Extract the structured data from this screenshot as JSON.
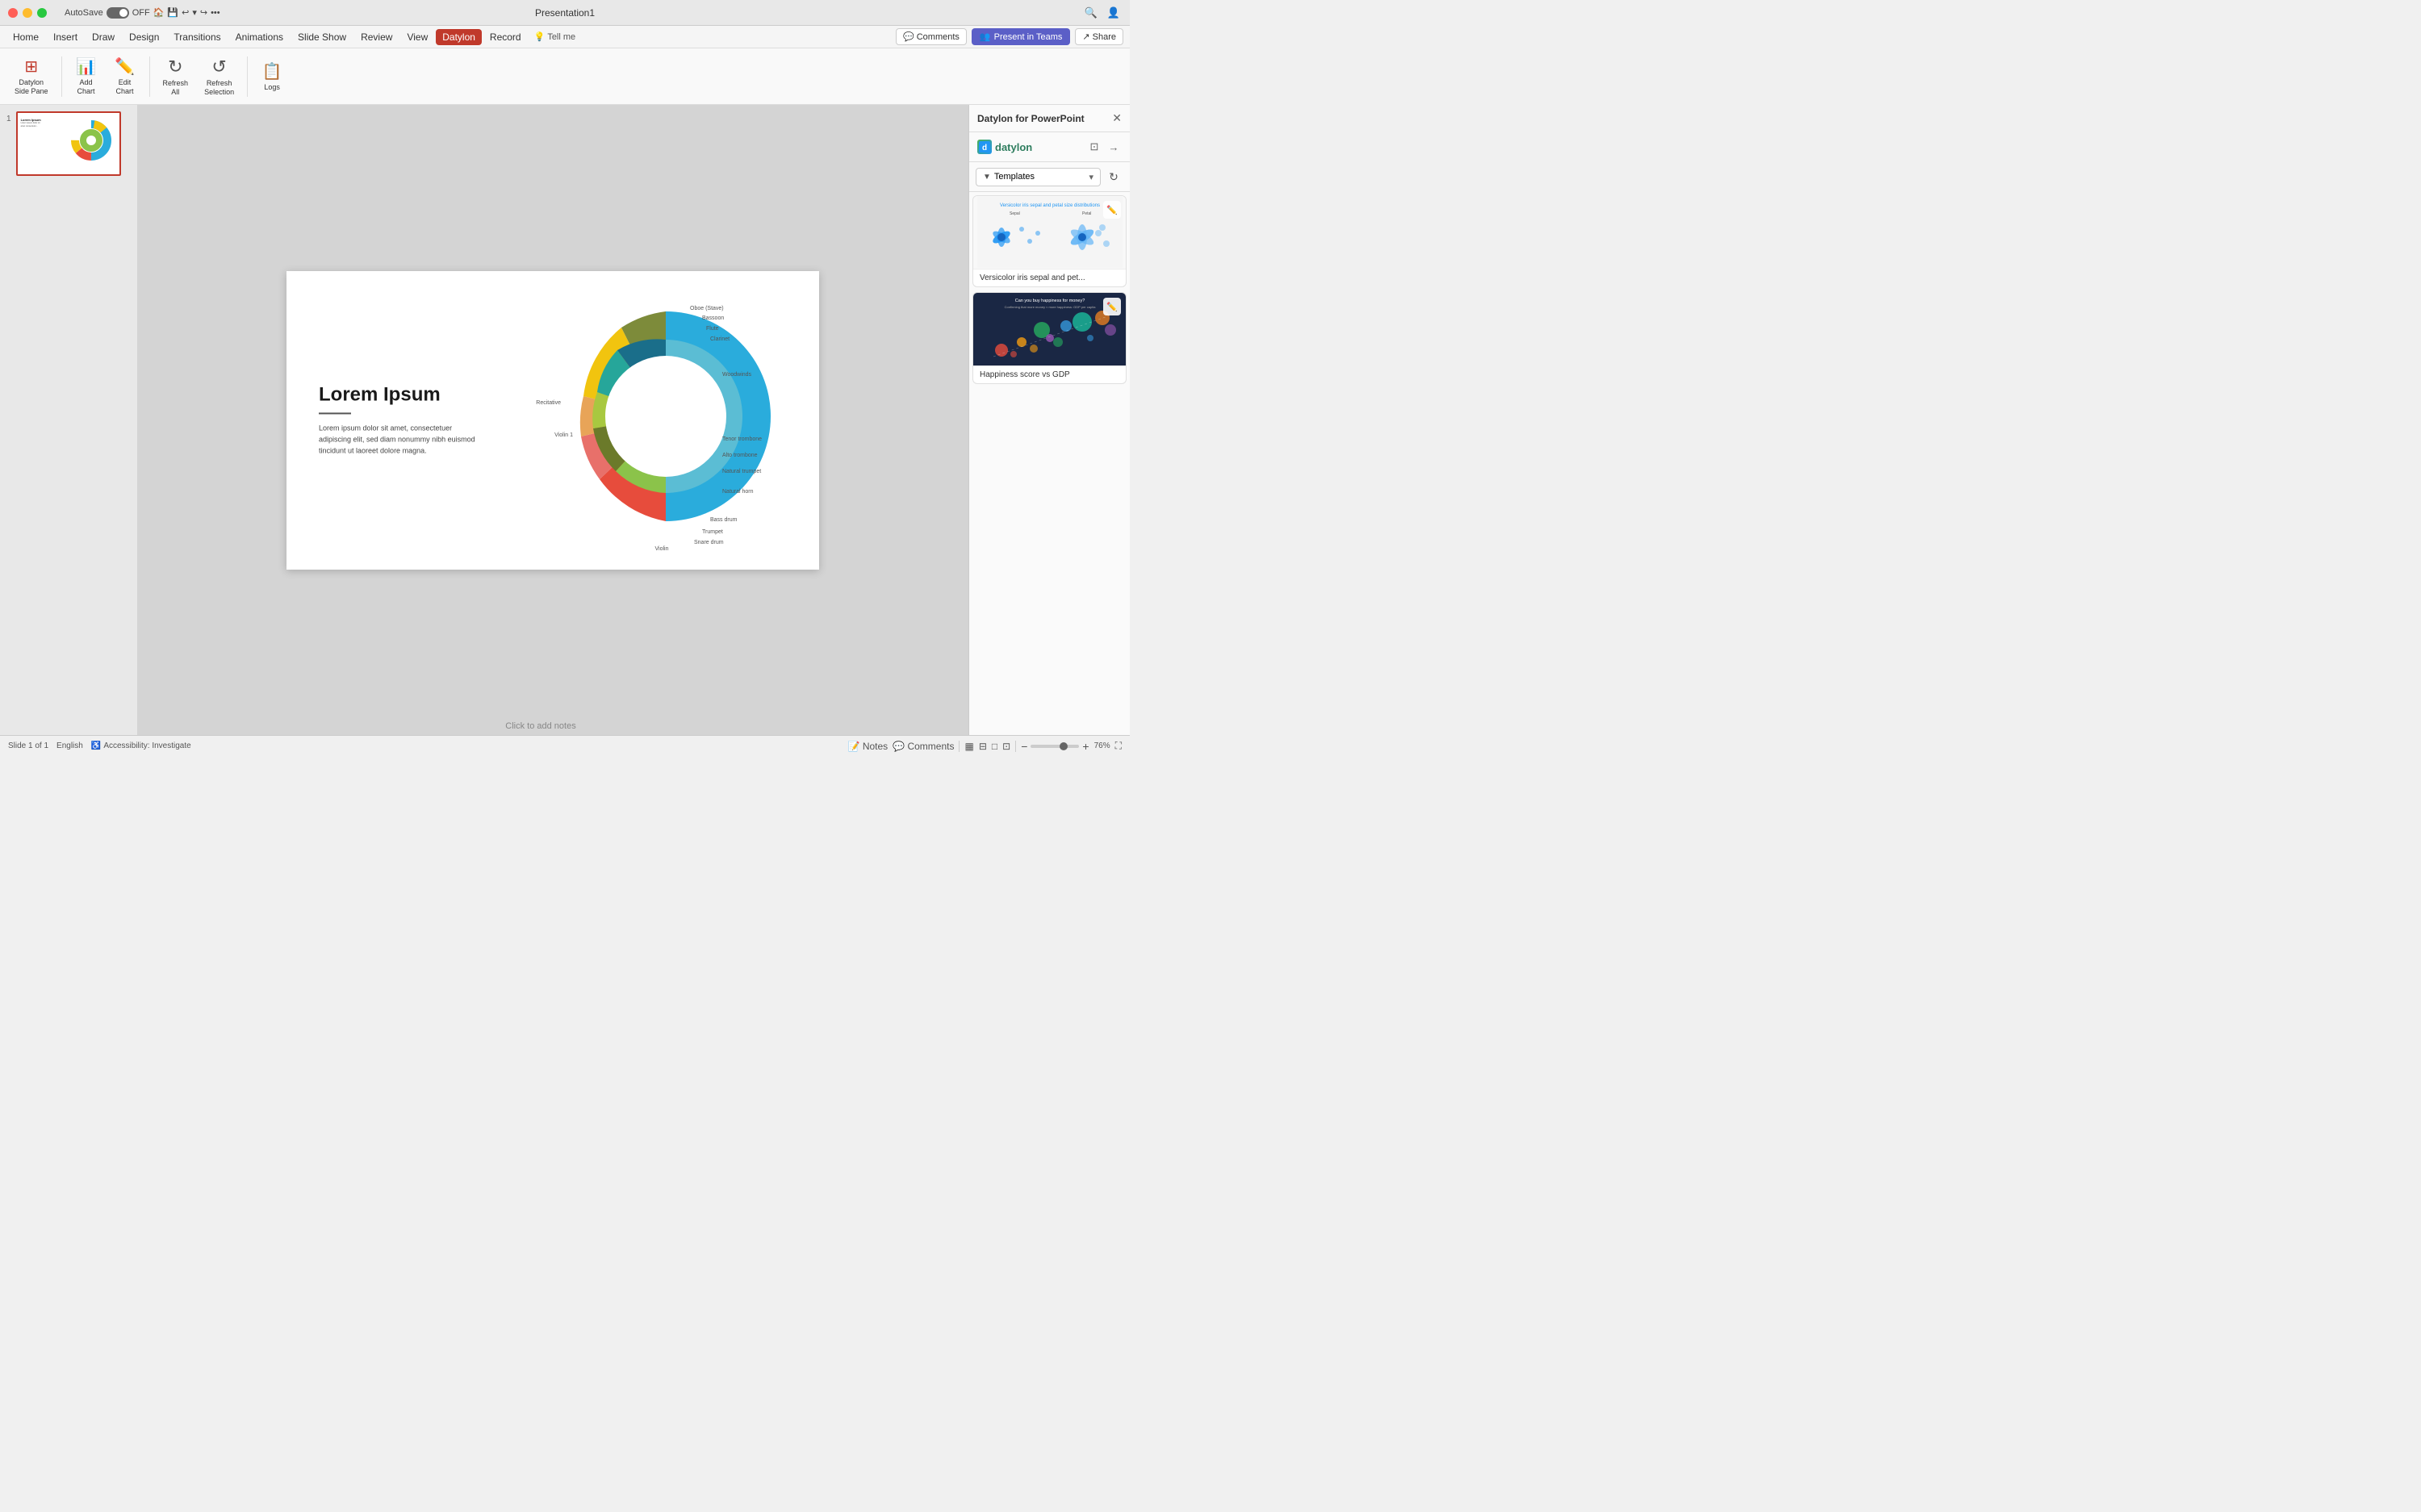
{
  "titleBar": {
    "appName": "Presentation1",
    "autosave": "AutoSave",
    "autosaveState": "OFF",
    "homeIcon": "🏠",
    "saveIcon": "💾",
    "undoIcon": "↩",
    "redoIcon": "↪",
    "moreIcon": "•••"
  },
  "menuBar": {
    "items": [
      "Home",
      "Insert",
      "Draw",
      "Design",
      "Transitions",
      "Animations",
      "Slide Show",
      "Review",
      "View",
      "Datylon",
      "Record"
    ],
    "activeItem": "Datylon",
    "tellMe": "Tell me",
    "comments": "Comments",
    "presentInTeams": "Present in Teams",
    "share": "Share"
  },
  "ribbon": {
    "buttons": [
      {
        "id": "datylon-side-pane",
        "icon": "⊞",
        "label": "Datylon\nSide Pane"
      },
      {
        "id": "add-chart",
        "icon": "📊",
        "label": "Add\nChart"
      },
      {
        "id": "edit-chart",
        "icon": "✏️",
        "label": "Edit\nChart"
      },
      {
        "id": "refresh-all",
        "icon": "↻",
        "label": "Refresh\nAll"
      },
      {
        "id": "refresh-selection",
        "icon": "↻",
        "label": "Refresh\nSelection"
      },
      {
        "id": "logs",
        "icon": "📋",
        "label": "Logs"
      }
    ]
  },
  "slidePanel": {
    "slideNumber": "1"
  },
  "slideCanvas": {
    "title": "Lorem Ipsum",
    "body": "Lorem ipsum dolor sit amet,\nconsectetuer adipiscing elit,\nsed diam nonummy nibh\neuismod tincidunt ut laoreet\ndolore magna."
  },
  "clickNotes": "Click to add notes",
  "sidePanel": {
    "title": "Datylon for PowerPoint",
    "logoText": "datylon",
    "templatesLabel": "Templates",
    "cards": [
      {
        "id": "versicolor",
        "label": "Versicolor iris sepal and pet...",
        "previewTitle": "Versicolor iris sepal and petal size distributions",
        "type": "scatter"
      },
      {
        "id": "happiness",
        "label": "Happiness score vs GDP",
        "previewTitle": "Can you buy happiness for money?",
        "type": "bubble-dark"
      }
    ]
  },
  "statusBar": {
    "slideInfo": "Slide 1 of 1",
    "language": "English",
    "accessibility": "Accessibility: Investigate",
    "viewNormal": "▦",
    "viewSlides": "▤",
    "viewOutline": "▥",
    "viewPresenter": "▣",
    "zoomMinus": "−",
    "zoomPlus": "+",
    "zoomLevel": "76%",
    "notes": "Notes",
    "comments": "Comments",
    "fitSlide": "⛶"
  },
  "chart": {
    "segments": [
      {
        "color": "#2AACDC",
        "startAngle": 0,
        "endAngle": 180,
        "ring": "outer"
      },
      {
        "color": "#E74C3C",
        "startAngle": 180,
        "endAngle": 230,
        "ring": "outer"
      },
      {
        "color": "#E8A458",
        "startAngle": 230,
        "endAngle": 270,
        "ring": "outer"
      },
      {
        "color": "#F1C40F",
        "startAngle": 270,
        "endAngle": 320,
        "ring": "outer"
      },
      {
        "color": "#8BC34A",
        "startAngle": 320,
        "endAngle": 360,
        "ring": "outer"
      }
    ]
  }
}
